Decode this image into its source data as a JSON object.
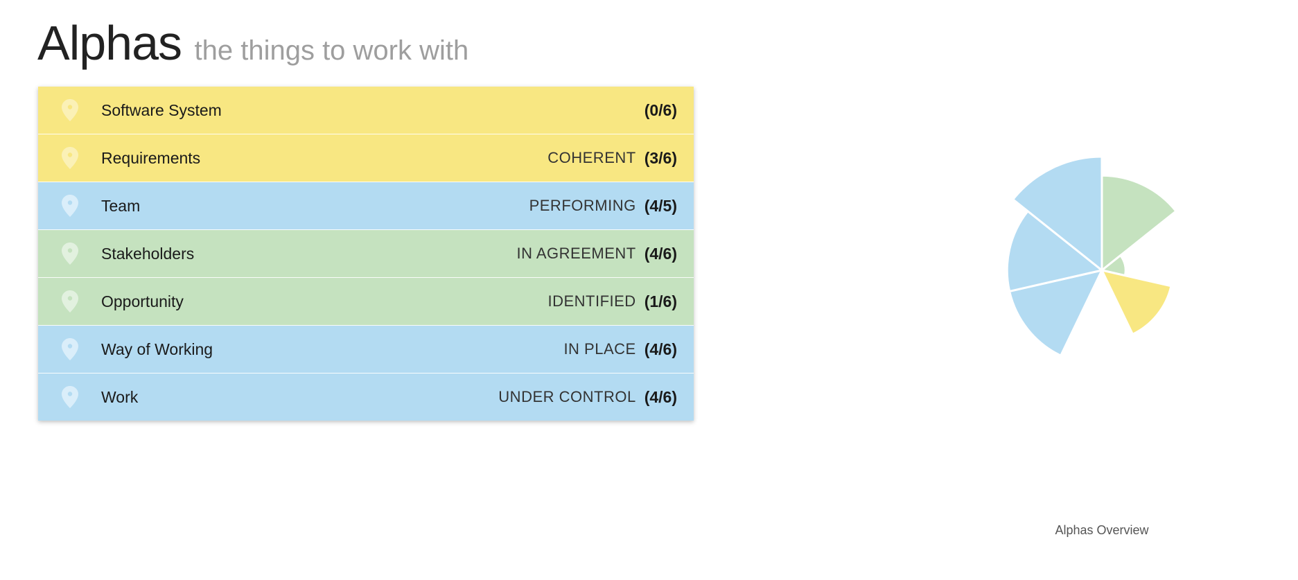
{
  "header": {
    "title": "Alphas",
    "subtitle": "the things to work with"
  },
  "colors": {
    "yellow": "#f8e782",
    "blue": "#b3dbf2",
    "green": "#c5e2bf",
    "yellow_pin": "#fbf1b6",
    "blue_pin": "#daeefa",
    "green_pin": "#e2f1df"
  },
  "alphas": [
    {
      "name": "Software System",
      "state": "",
      "count": "(0/6)",
      "color": "yellow",
      "icon": "map-pin-icon"
    },
    {
      "name": "Requirements",
      "state": "COHERENT",
      "count": "(3/6)",
      "color": "yellow",
      "icon": "map-pin-icon"
    },
    {
      "name": "Team",
      "state": "PERFORMING",
      "count": "(4/5)",
      "color": "blue",
      "icon": "map-pin-icon"
    },
    {
      "name": "Stakeholders",
      "state": "IN AGREEMENT",
      "count": "(4/6)",
      "color": "green",
      "icon": "map-pin-icon"
    },
    {
      "name": "Opportunity",
      "state": "IDENTIFIED",
      "count": "(1/6)",
      "color": "green",
      "icon": "map-pin-icon"
    },
    {
      "name": "Way of Working",
      "state": "IN PLACE",
      "count": "(4/6)",
      "color": "blue",
      "icon": "map-pin-icon"
    },
    {
      "name": "Work",
      "state": "UNDER CONTROL",
      "count": "(4/6)",
      "color": "blue",
      "icon": "map-pin-icon"
    }
  ],
  "chart_data": {
    "type": "polar_area",
    "title": "Alphas Overview",
    "categories": [
      "Stakeholders",
      "Opportunity",
      "Requirements",
      "Software System",
      "Work",
      "Way of Working",
      "Team"
    ],
    "values": [
      0.667,
      0.167,
      0.5,
      0.0,
      0.667,
      0.667,
      0.8
    ],
    "colors": [
      "green",
      "green",
      "yellow",
      "yellow",
      "blue",
      "blue",
      "blue"
    ]
  }
}
